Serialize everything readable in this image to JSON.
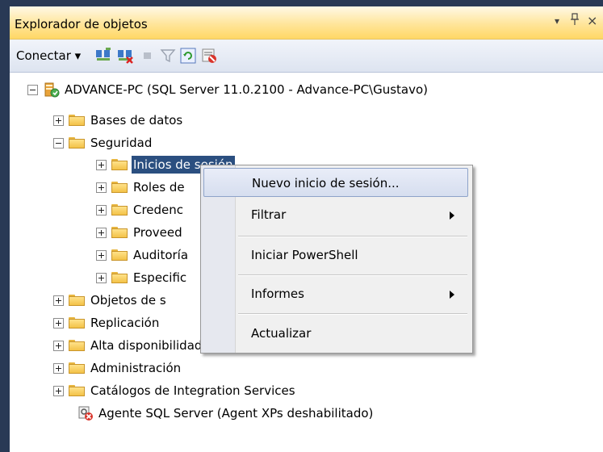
{
  "panel": {
    "title": "Explorador de objetos",
    "pin_glyph": "▾",
    "pushpin_glyph": "╨",
    "close_glyph": "×"
  },
  "toolbar": {
    "connect_label": "Conectar ▾",
    "icons": [
      "connect-object-explorer-icon",
      "disconnect-icon",
      "stop-icon",
      "filter-icon",
      "refresh-icon",
      "activity-monitor-icon"
    ]
  },
  "tree": {
    "server": "ADVANCE-PC (SQL Server 11.0.2100 - Advance-PC\\Gustavo)",
    "databases": "Bases de datos",
    "security": "Seguridad",
    "logins": "Inicios de sesión",
    "roles": "Roles de",
    "credentials": "Credenc",
    "providers": "Proveed",
    "audits": "Auditoría",
    "specs": "Especific",
    "server_objects": "Objetos de s",
    "replication": "Replicación",
    "always_on": "Alta disponibilidad AlwaysOn",
    "management": "Administración",
    "integration": "Catálogos de Integration Services",
    "agent": "Agente SQL Server (Agent XPs deshabilitado)"
  },
  "context_menu": {
    "new_login": "Nuevo inicio de sesión...",
    "filter": "Filtrar",
    "powershell": "Iniciar PowerShell",
    "reports": "Informes",
    "refresh": "Actualizar"
  },
  "colors": {
    "frame": "#293955",
    "titlebar": "#ffe59a",
    "selection": "#2b4f80"
  }
}
